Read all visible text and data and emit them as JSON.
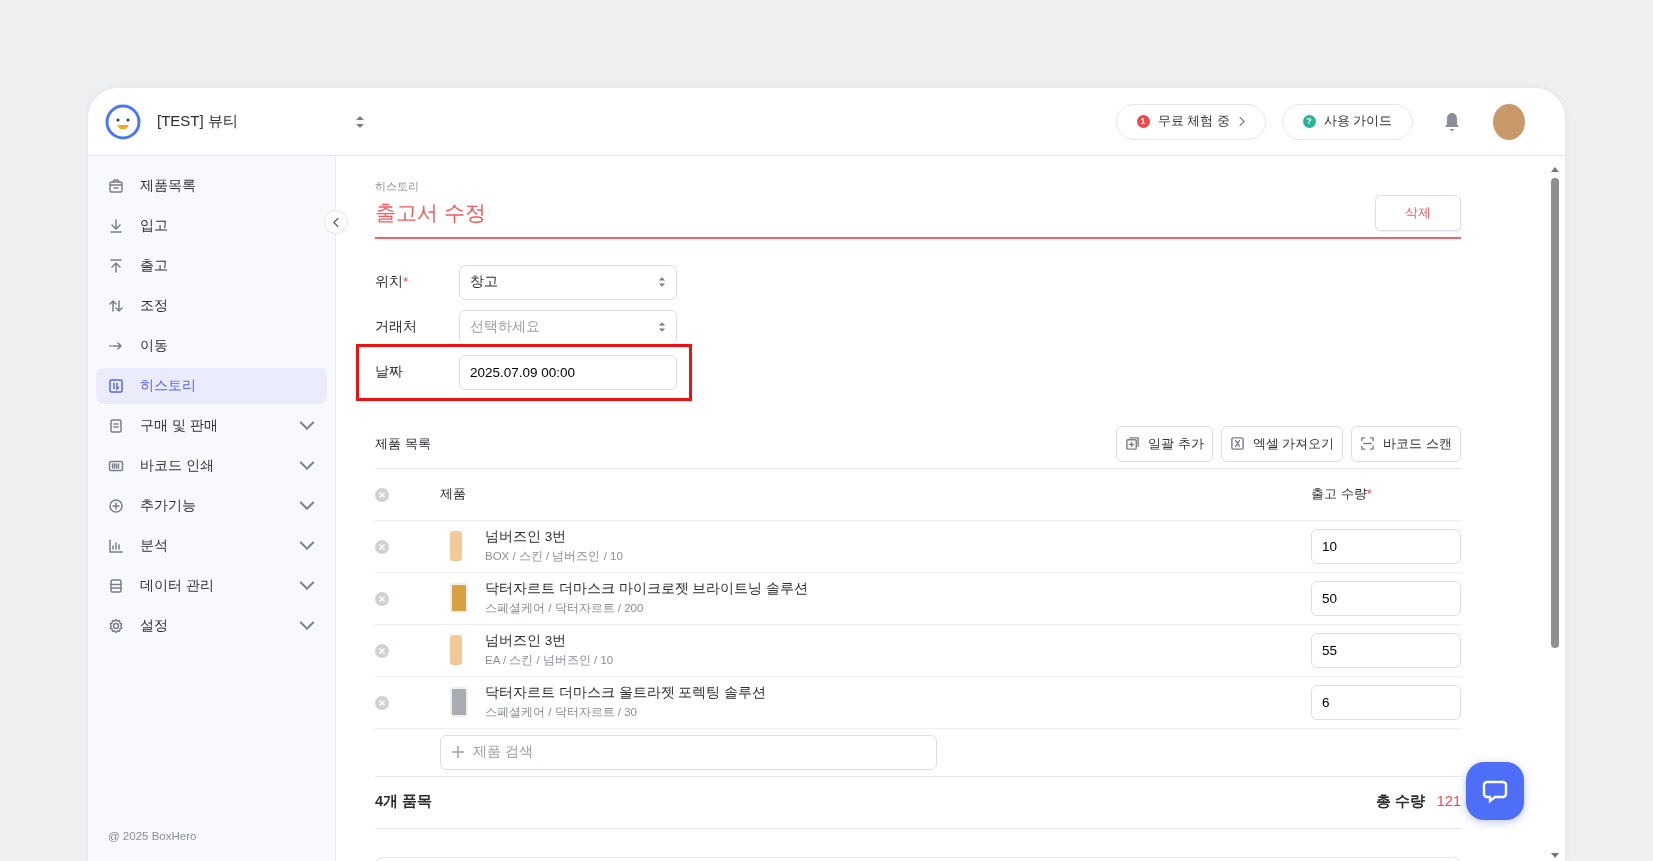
{
  "workspace": {
    "name": "[TEST] 뷰티"
  },
  "header": {
    "trial": {
      "badge": "1",
      "label": "무료 체험 중"
    },
    "guide": {
      "badge": "?",
      "label": "사용 가이드"
    }
  },
  "sidebar": {
    "items": [
      {
        "label": "제품목록",
        "selected": false,
        "expandable": false
      },
      {
        "label": "입고",
        "selected": false,
        "expandable": false
      },
      {
        "label": "출고",
        "selected": false,
        "expandable": false
      },
      {
        "label": "조정",
        "selected": false,
        "expandable": false
      },
      {
        "label": "이동",
        "selected": false,
        "expandable": false
      },
      {
        "label": "히스토리",
        "selected": true,
        "expandable": false
      },
      {
        "label": "구매 및 판매",
        "selected": false,
        "expandable": true
      },
      {
        "label": "바코드 인쇄",
        "selected": false,
        "expandable": true
      },
      {
        "label": "추가기능",
        "selected": false,
        "expandable": true
      },
      {
        "label": "분석",
        "selected": false,
        "expandable": true
      },
      {
        "label": "데이터 관리",
        "selected": false,
        "expandable": true
      },
      {
        "label": "설정",
        "selected": false,
        "expandable": true
      }
    ],
    "footer": "@ 2025 BoxHero"
  },
  "page": {
    "breadcrumb": "히스토리",
    "title": "출고서 수정",
    "delete_button": "삭제"
  },
  "form": {
    "fields": [
      {
        "label": "위치",
        "required_mark": "*",
        "kind": "select",
        "value": "창고",
        "highlighted": false
      },
      {
        "label": "거래처",
        "kind": "select",
        "placeholder": "선택하세요",
        "highlighted": false
      },
      {
        "label": "날짜",
        "kind": "text",
        "value": "2025.07.09 00:00",
        "highlighted": true
      }
    ]
  },
  "products": {
    "title": "제품 목록",
    "actions": [
      {
        "label": "일괄 추가"
      },
      {
        "label": "엑셀 가져오기"
      },
      {
        "label": "바코드 스캔"
      }
    ],
    "columns": [
      {
        "label": "제품"
      },
      {
        "label": "출고 수량",
        "required_mark": "*"
      }
    ],
    "rows": [
      {
        "name": "넘버즈인 3번",
        "details": "BOX / 스킨 / 넘버즈인 / 10",
        "quantity": "10"
      },
      {
        "name": "닥터자르트 더마스크 마이크로젯 브라이트닝 솔루션",
        "details": "스페셜케어 / 닥터자르트 / 200",
        "quantity": "50"
      },
      {
        "name": "넘버즈인 3번",
        "details": "EA / 스킨 / 넘버즈인 / 10",
        "quantity": "55"
      },
      {
        "name": "닥터자르트 더마스크 울트라젯 포렉팅 솔루션",
        "details": "스페셜케어 / 닥터자르트 / 30",
        "quantity": "6"
      }
    ],
    "search": {
      "placeholder": "제품 검색"
    },
    "item_count": "4개 품목",
    "total_label": "총 수량",
    "total": "121"
  }
}
